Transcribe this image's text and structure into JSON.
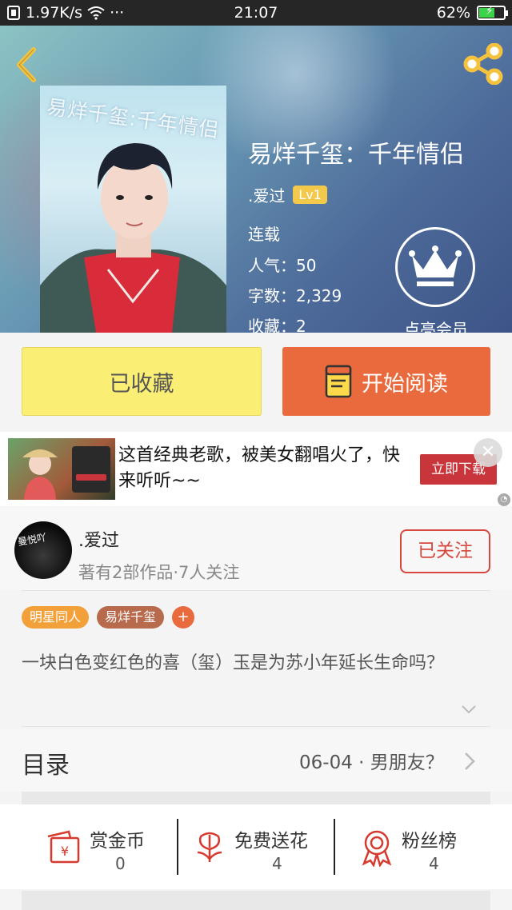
{
  "status_bar": {
    "speed": "1.97K/s",
    "dots": "···",
    "time": "21:07",
    "battery_text": "62%",
    "battery_level": 0.62
  },
  "book": {
    "title": "易烊千玺：千年情侣",
    "cover_text": "易烊千玺:千年情侣",
    "author": ".爱过",
    "level": "Lv1",
    "status": "连载",
    "popularity": "人气：50",
    "words": "字数：2,329",
    "favorites": "收藏：2"
  },
  "vip": {
    "label": "点亮会员"
  },
  "actions": {
    "favorited_label": "已收藏",
    "read_label": "开始阅读"
  },
  "ad": {
    "text": "这首经典老歌，被美女翻唱火了，快来听听~~",
    "button": "立即下载",
    "close": "✕"
  },
  "author_card": {
    "avatar_text": "曼悦吖",
    "name": ".爱过",
    "works": "著有2部作品·7人关注",
    "follow_label": "已关注"
  },
  "tags": [
    {
      "label": "明星同人",
      "color": "#f2a13a"
    },
    {
      "label": "易烊千玺",
      "color": "#b86a4c"
    }
  ],
  "tag_add": "+",
  "description": "一块白色变红色的喜（玺）玉是为苏小年延长生命吗？",
  "toc": {
    "label": "目录",
    "latest": "06-04 · 男朋友？"
  },
  "stats": [
    {
      "label": "赏金币",
      "value": "0",
      "icon": "gold-coin-envelope-icon"
    },
    {
      "label": "免费送花",
      "value": "4",
      "icon": "flower-icon"
    },
    {
      "label": "粉丝榜",
      "value": "4",
      "icon": "medal-icon"
    }
  ],
  "colors": {
    "accent_orange": "#e86a3d",
    "fav_yellow": "#fbee74",
    "follow_red": "#d6473e",
    "icon_red": "#d63a2e"
  }
}
